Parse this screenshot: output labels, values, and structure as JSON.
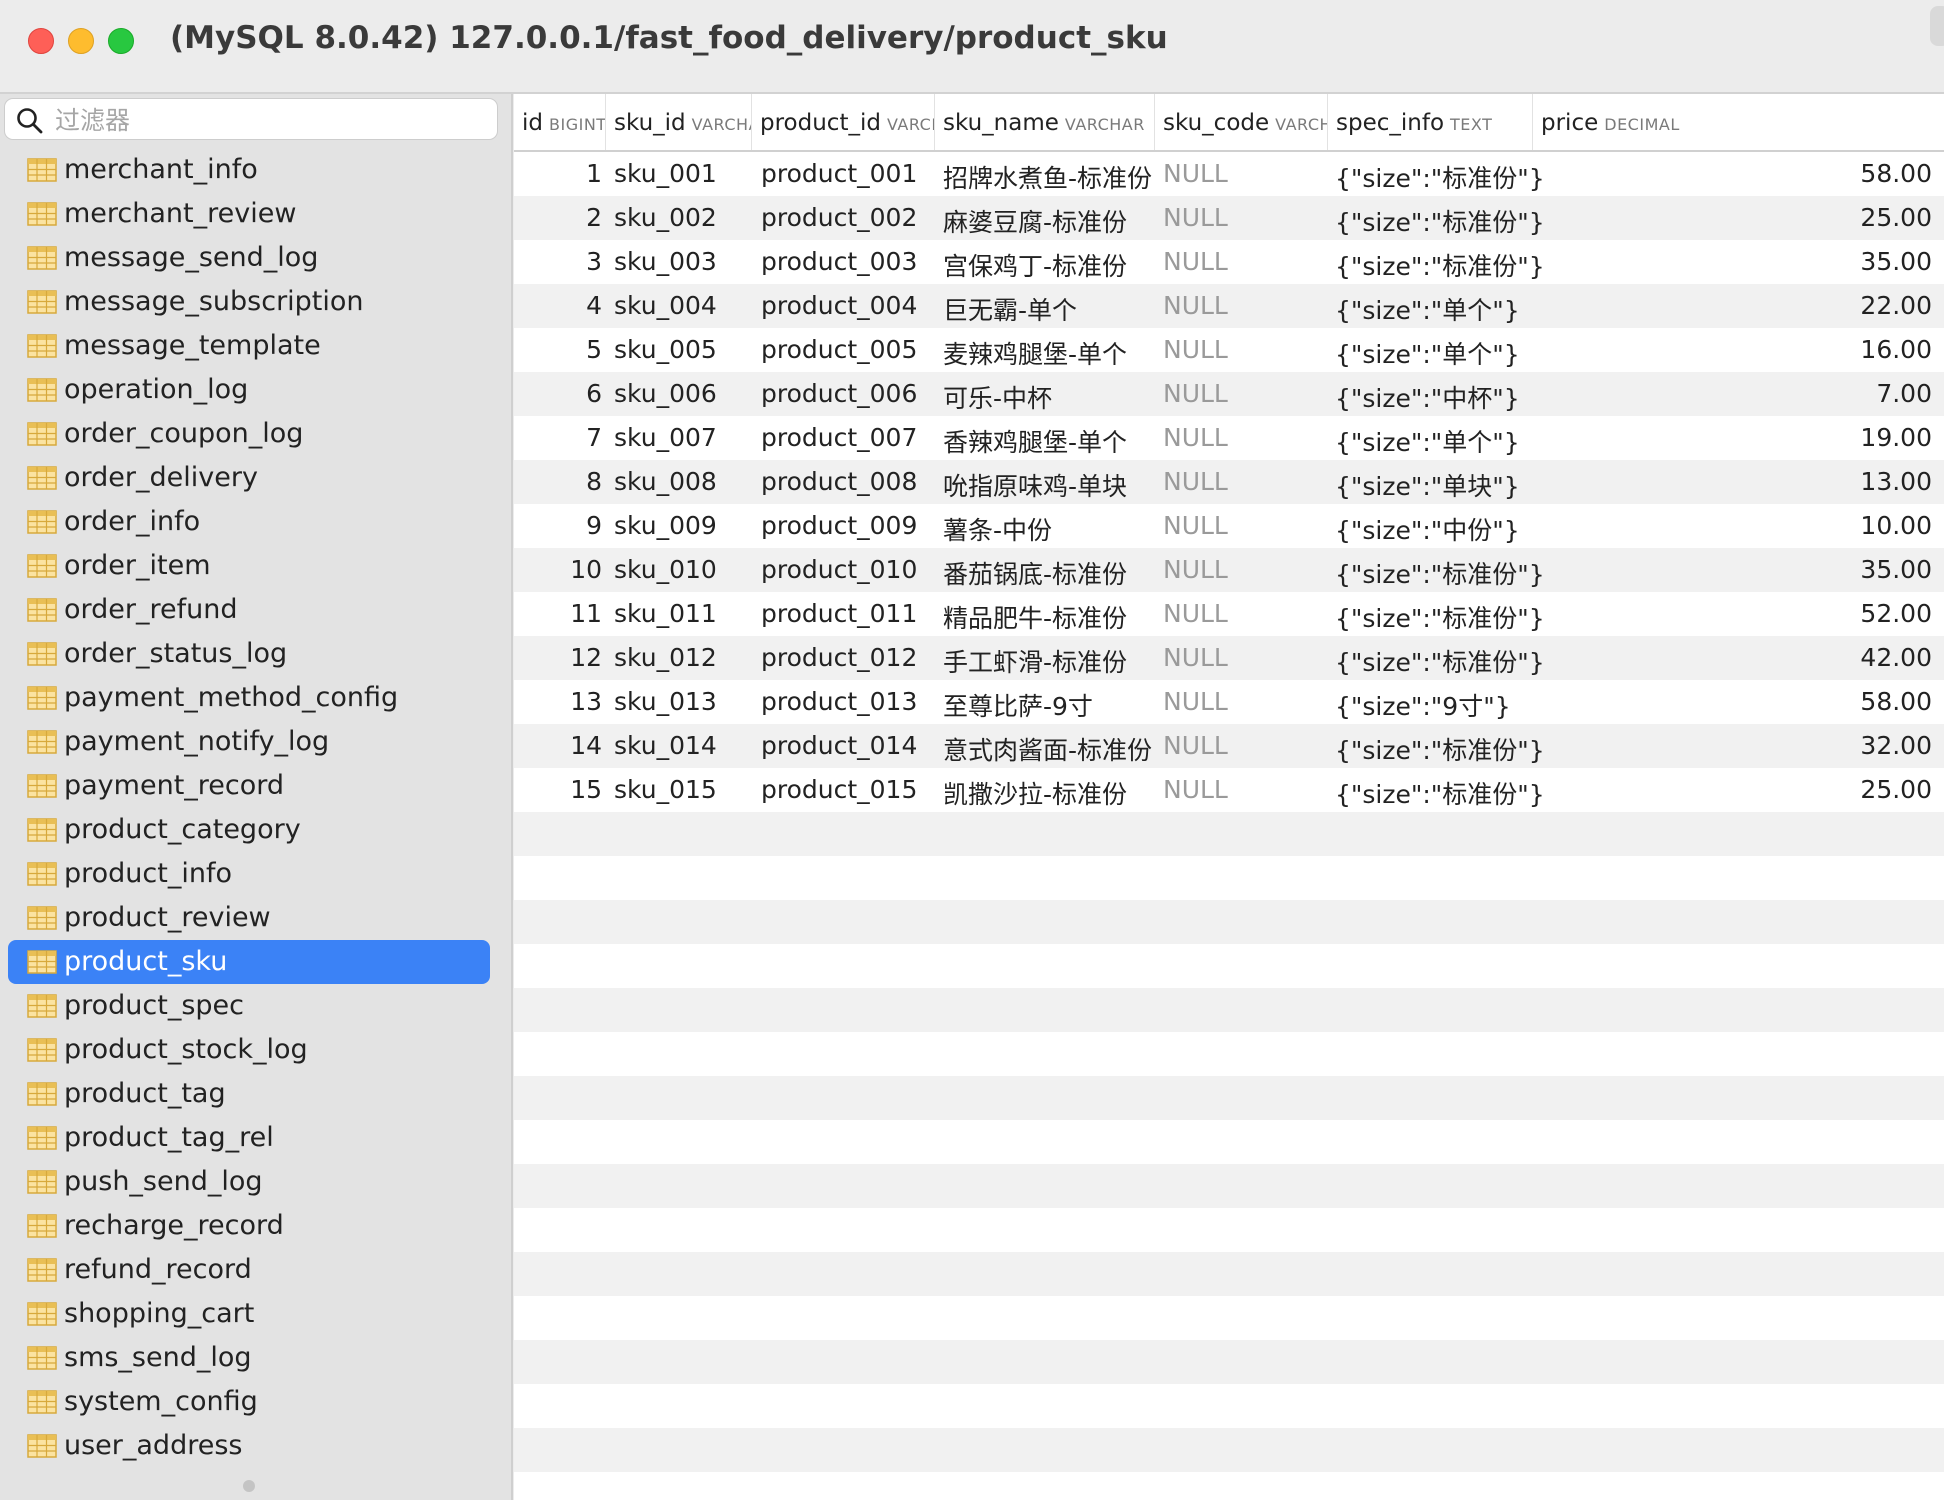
{
  "window": {
    "title": "(MySQL 8.0.42) 127.0.0.1/fast_food_delivery/product_sku"
  },
  "sidebar": {
    "filter_placeholder": "过滤器",
    "items": [
      {
        "label": "merchant_info"
      },
      {
        "label": "merchant_review"
      },
      {
        "label": "message_send_log"
      },
      {
        "label": "message_subscription"
      },
      {
        "label": "message_template"
      },
      {
        "label": "operation_log"
      },
      {
        "label": "order_coupon_log"
      },
      {
        "label": "order_delivery"
      },
      {
        "label": "order_info"
      },
      {
        "label": "order_item"
      },
      {
        "label": "order_refund"
      },
      {
        "label": "order_status_log"
      },
      {
        "label": "payment_method_config"
      },
      {
        "label": "payment_notify_log"
      },
      {
        "label": "payment_record"
      },
      {
        "label": "product_category"
      },
      {
        "label": "product_info"
      },
      {
        "label": "product_review"
      },
      {
        "label": "product_sku",
        "selected": true
      },
      {
        "label": "product_spec"
      },
      {
        "label": "product_stock_log"
      },
      {
        "label": "product_tag"
      },
      {
        "label": "product_tag_rel"
      },
      {
        "label": "push_send_log"
      },
      {
        "label": "recharge_record"
      },
      {
        "label": "refund_record"
      },
      {
        "label": "shopping_cart"
      },
      {
        "label": "sms_send_log"
      },
      {
        "label": "system_config"
      },
      {
        "label": "user_address"
      }
    ]
  },
  "table": {
    "columns": [
      {
        "name": "id",
        "type": "BIGINT"
      },
      {
        "name": "sku_id",
        "type": "VARCHAR"
      },
      {
        "name": "product_id",
        "type": "VARCHAR"
      },
      {
        "name": "sku_name",
        "type": "VARCHAR"
      },
      {
        "name": "sku_code",
        "type": "VARCHAR"
      },
      {
        "name": "spec_info",
        "type": "TEXT"
      },
      {
        "name": "price",
        "type": "DECIMAL"
      }
    ],
    "rows": [
      [
        "1",
        "sku_001",
        "product_001",
        "招牌水煮鱼-标准份",
        "NULL",
        "{\"size\":\"标准份\"}",
        "58.00"
      ],
      [
        "2",
        "sku_002",
        "product_002",
        "麻婆豆腐-标准份",
        "NULL",
        "{\"size\":\"标准份\"}",
        "25.00"
      ],
      [
        "3",
        "sku_003",
        "product_003",
        "宫保鸡丁-标准份",
        "NULL",
        "{\"size\":\"标准份\"}",
        "35.00"
      ],
      [
        "4",
        "sku_004",
        "product_004",
        "巨无霸-单个",
        "NULL",
        "{\"size\":\"单个\"}",
        "22.00"
      ],
      [
        "5",
        "sku_005",
        "product_005",
        "麦辣鸡腿堡-单个",
        "NULL",
        "{\"size\":\"单个\"}",
        "16.00"
      ],
      [
        "6",
        "sku_006",
        "product_006",
        "可乐-中杯",
        "NULL",
        "{\"size\":\"中杯\"}",
        "7.00"
      ],
      [
        "7",
        "sku_007",
        "product_007",
        "香辣鸡腿堡-单个",
        "NULL",
        "{\"size\":\"单个\"}",
        "19.00"
      ],
      [
        "8",
        "sku_008",
        "product_008",
        "吮指原味鸡-单块",
        "NULL",
        "{\"size\":\"单块\"}",
        "13.00"
      ],
      [
        "9",
        "sku_009",
        "product_009",
        "薯条-中份",
        "NULL",
        "{\"size\":\"中份\"}",
        "10.00"
      ],
      [
        "10",
        "sku_010",
        "product_010",
        "番茄锅底-标准份",
        "NULL",
        "{\"size\":\"标准份\"}",
        "35.00"
      ],
      [
        "11",
        "sku_011",
        "product_011",
        "精品肥牛-标准份",
        "NULL",
        "{\"size\":\"标准份\"}",
        "52.00"
      ],
      [
        "12",
        "sku_012",
        "product_012",
        "手工虾滑-标准份",
        "NULL",
        "{\"size\":\"标准份\"}",
        "42.00"
      ],
      [
        "13",
        "sku_013",
        "product_013",
        "至尊比萨-9寸",
        "NULL",
        "{\"size\":\"9寸\"}",
        "58.00"
      ],
      [
        "14",
        "sku_014",
        "product_014",
        "意式肉酱面-标准份",
        "NULL",
        "{\"size\":\"标准份\"}",
        "32.00"
      ],
      [
        "15",
        "sku_015",
        "product_015",
        "凯撒沙拉-标准份",
        "NULL",
        "{\"size\":\"标准份\"}",
        "25.00"
      ]
    ]
  }
}
